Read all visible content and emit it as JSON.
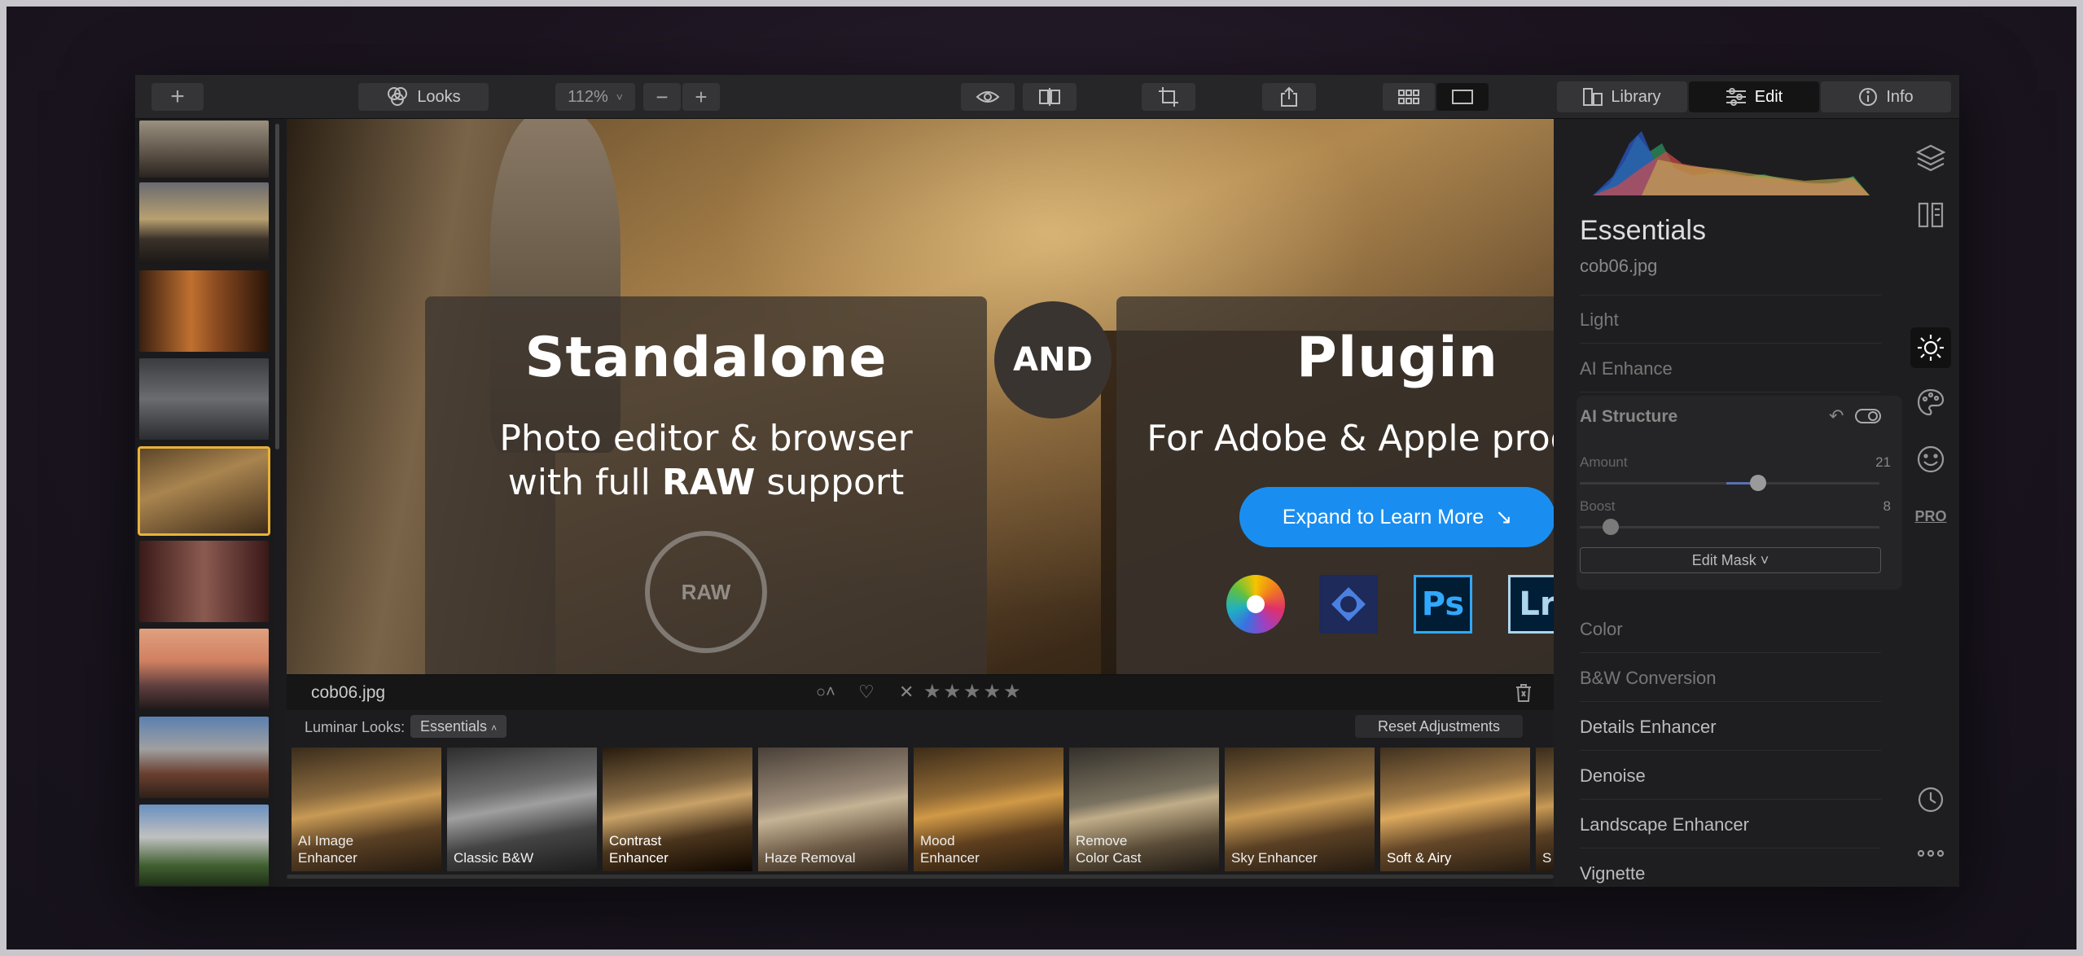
{
  "toolbar": {
    "add_label": "+",
    "looks_label": "Looks",
    "zoom_value": "112%",
    "zoom_out_label": "−",
    "zoom_in_label": "+",
    "tabs": [
      {
        "label": "Library"
      },
      {
        "label": "Edit"
      },
      {
        "label": "Info"
      }
    ]
  },
  "promo": {
    "left_title": "Standalone",
    "left_line1": "Photo editor & browser",
    "left_line2_pre": "with full ",
    "left_line2_bold": "RAW",
    "left_line2_post": " support",
    "raw_logo": "RAW",
    "and_label": "AND",
    "right_title": "Plugin",
    "right_sub": "For Adobe & Apple products",
    "cta_label": "Expand to Learn More",
    "cta_arrow": "↘",
    "products": [
      {
        "name": "apple-photos",
        "label": ""
      },
      {
        "name": "photoshop-elements",
        "label": ""
      },
      {
        "name": "photoshop",
        "label": "Ps"
      },
      {
        "name": "lightroom",
        "label": "Lr"
      }
    ]
  },
  "photo_info": {
    "filename": "cob06.jpg",
    "stars": "★★★★★",
    "reject": "✕"
  },
  "looks": {
    "prefix": "Luminar Looks:",
    "collection": "Essentials",
    "reset_label": "Reset Adjustments",
    "items": [
      {
        "label": "AI Image Enhancer",
        "l1": "AI Image",
        "l2": "Enhancer"
      },
      {
        "label": "Classic B&W",
        "l1": "Classic B&W",
        "l2": ""
      },
      {
        "label": "Contrast Enhancer",
        "l1": "Contrast",
        "l2": "Enhancer"
      },
      {
        "label": "Haze Removal",
        "l1": "Haze Removal",
        "l2": ""
      },
      {
        "label": "Mood Enhancer",
        "l1": "Mood",
        "l2": "Enhancer"
      },
      {
        "label": "Remove Color Cast",
        "l1": "Remove",
        "l2": "Color Cast"
      },
      {
        "label": "Sky Enhancer",
        "l1": "Sky Enhancer",
        "l2": ""
      },
      {
        "label": "Soft & Airy",
        "l1": "Soft & Airy",
        "l2": ""
      },
      {
        "label": "S",
        "l1": "S",
        "l2": ""
      }
    ]
  },
  "panel": {
    "title": "Essentials",
    "filename": "cob06.jpg",
    "items_top": [
      "Light",
      "AI Enhance"
    ],
    "ai_structure": {
      "title": "AI Structure",
      "amount_label": "Amount",
      "amount_value": "21",
      "amount_level": 0.6,
      "boost_label": "Boost",
      "boost_value": "8",
      "boost_level": 0.08,
      "edit_mask": "Edit Mask ˅"
    },
    "items_bottom": [
      "Color",
      "B&W Conversion",
      "Details Enhancer",
      "Denoise",
      "Landscape Enhancer",
      "Vignette"
    ],
    "pro_label": "PRO"
  },
  "colors": {
    "accent": "#1a8ef0",
    "selected_thumb": "#e8b23a"
  }
}
